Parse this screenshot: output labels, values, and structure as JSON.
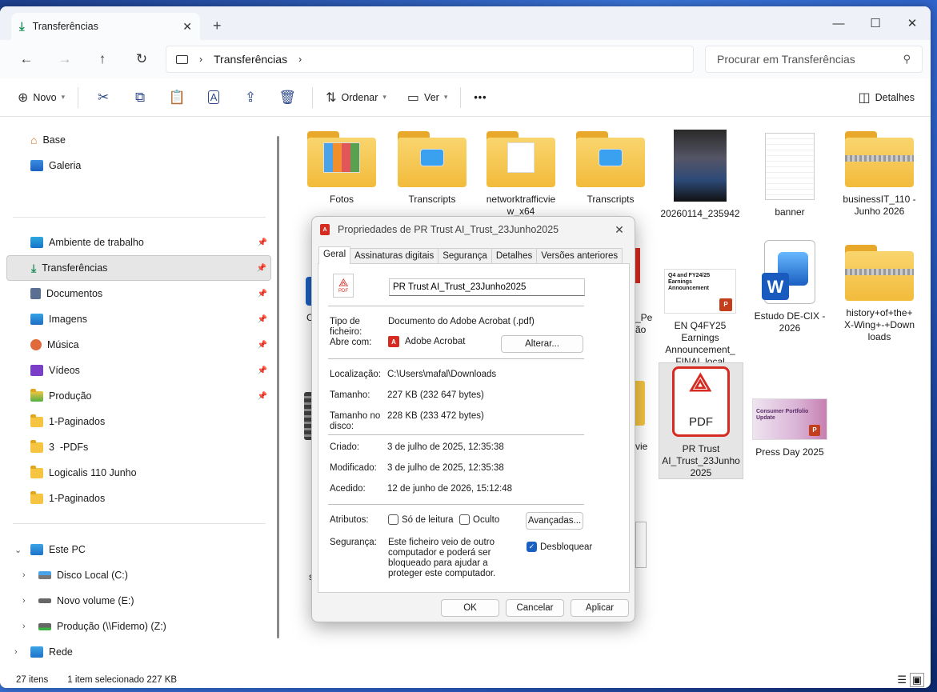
{
  "window": {
    "tab_title": "Transferências",
    "new_tab": "+",
    "controls": {
      "minimize": "—",
      "maximize": "☐",
      "close": "✕"
    }
  },
  "nav": {
    "back": "←",
    "forward": "→",
    "up": "↑",
    "refresh": "↻",
    "breadcrumb": [
      "Transferências"
    ],
    "search_placeholder": "Procurar em Transferências"
  },
  "toolbar": {
    "new_label": "Novo",
    "sort_label": "Ordenar",
    "view_label": "Ver",
    "more": "•••",
    "details_label": "Detalhes"
  },
  "sidebar": {
    "top": [
      {
        "label": "Base",
        "icon": "home-icon"
      },
      {
        "label": "Galeria",
        "icon": "gallery-icon"
      }
    ],
    "quick_access": [
      {
        "label": "Ambiente de trabalho",
        "pinned": true
      },
      {
        "label": "Transferências",
        "pinned": true,
        "selected": true
      },
      {
        "label": "Documentos",
        "pinned": true
      },
      {
        "label": "Imagens",
        "pinned": true
      },
      {
        "label": "Música",
        "pinned": true
      },
      {
        "label": "Vídeos",
        "pinned": true
      },
      {
        "label": "Produção",
        "pinned": true
      },
      {
        "label": "1-Paginados",
        "pinned": false
      },
      {
        "label": "3  -PDFs",
        "pinned": false
      },
      {
        "label": "Logicalis 110 Junho",
        "pinned": false
      },
      {
        "label": "1-Paginados",
        "pinned": false
      }
    ],
    "this_pc": "Este PC",
    "drives": [
      "Disco Local (C:)",
      "Novo volume (E:)",
      "Produção (\\\\Fidemo) (Z:)"
    ],
    "network": "Rede"
  },
  "files": [
    {
      "name": "Fotos",
      "kind": "folder-photos"
    },
    {
      "name": "Transcripts",
      "kind": "folder-app"
    },
    {
      "name": "networktrafficvie\nw_x64",
      "kind": "folder-doc"
    },
    {
      "name": "Transcripts",
      "kind": "folder-app"
    },
    {
      "name": "20260114_235942",
      "kind": "photo"
    },
    {
      "name": "banner",
      "kind": "blank-doc"
    },
    {
      "name": "businessIT_110 -\nJunho 2026",
      "kind": "zip-folder"
    },
    {
      "name": "EN Q4FY25\nEarnings\nAnnouncement_\nFINAL local",
      "kind": "slides"
    },
    {
      "name": "Estudo DE-CIX -\n2026",
      "kind": "word"
    },
    {
      "name": "history+of+the+\nX-Wing+-+Down\nloads",
      "kind": "zip-folder"
    },
    {
      "name": "PR Trust\nAI_Trust_23Junho\n2025",
      "kind": "pdf",
      "selected": true
    },
    {
      "name": "Press Day 2025",
      "kind": "slides-pink"
    }
  ],
  "thumbs": {
    "slides_text": "Q4 and FY24/25 Earnings Announcement",
    "press_text": "Consumer Portfolio Update",
    "pdf_text": "PDF",
    "word_letter": "W",
    "mini_p": "P"
  },
  "partial_labels": {
    "l1": "_Pe",
    "l2": "ão",
    "l3": "vie",
    "l4": "C",
    "l5": "s"
  },
  "status": {
    "count": "27 itens",
    "selection": "1 item selecionado 227 KB"
  },
  "dialog": {
    "title": "Propriedades de PR Trust AI_Trust_23Junho2025",
    "tabs": [
      "Geral",
      "Assinaturas digitais",
      "Segurança",
      "Detalhes",
      "Versões anteriores"
    ],
    "file_name": "PR Trust AI_Trust_23Junho2025",
    "type_label": "Tipo de ficheiro:",
    "type_value": "Documento do Adobe Acrobat (.pdf)",
    "opens_label": "Abre com:",
    "opens_value": "Adobe Acrobat",
    "change_btn": "Alterar...",
    "location_label": "Localização:",
    "location_value": "C:\\Users\\mafal\\Downloads",
    "size_label": "Tamanho:",
    "size_value": "227 KB (232 647 bytes)",
    "disk_label": "Tamanho no disco:",
    "disk_value": "228 KB (233 472 bytes)",
    "created_label": "Criado:",
    "created_value": "3 de julho de 2025, 12:35:38",
    "modified_label": "Modificado:",
    "modified_value": "3 de julho de 2025, 12:35:38",
    "accessed_label": "Acedido:",
    "accessed_value": "12 de junho de 2026, 15:12:48",
    "attributes_label": "Atributos:",
    "readonly_label": "Só de leitura",
    "hidden_label": "Oculto",
    "advanced_btn": "Avançadas...",
    "security_label": "Segurança:",
    "security_text": "Este ficheiro veio de outro computador e poderá ser bloqueado para ajudar a proteger este computador.",
    "unblock_label": "Desbloquear",
    "unblock_checked": true,
    "ok": "OK",
    "cancel": "Cancelar",
    "apply": "Aplicar"
  }
}
